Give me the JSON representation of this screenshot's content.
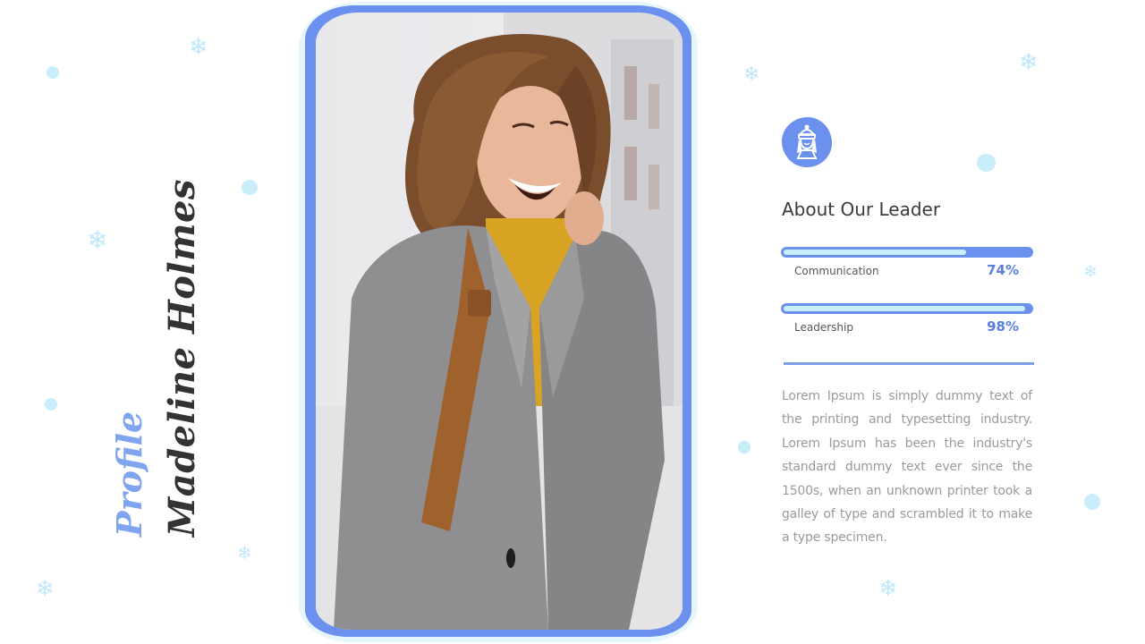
{
  "slide": {
    "title": "Madeline Holmes",
    "subtitle": "Profile",
    "photo": {
      "description": "Smiling woman with brown hair in grey coat and yellow sweater, snowy street"
    },
    "avatar_icon": "winter-girl-icon",
    "section_title": "About Our Leader",
    "skills": [
      {
        "label": "Communication",
        "value_text": "74%",
        "value": 74
      },
      {
        "label": "Leadership",
        "value_text": "98%",
        "value": 98
      }
    ],
    "body_text": "Lorem Ipsum is simply dummy text of the printing and typesetting industry.  Lorem Ipsum has been the industry's standard dummy text ever since the 1500s,  when an unknown printer took a galley of type and scrambled it to make a type specimen.",
    "decorations": {
      "snowflake_glyph": "❄"
    }
  },
  "colors": {
    "accent": "#6b90ee",
    "accent_light": "#c9eefb",
    "title": "#333333",
    "subtitle": "#7fa4f0",
    "body_text": "#9a9a9a"
  }
}
